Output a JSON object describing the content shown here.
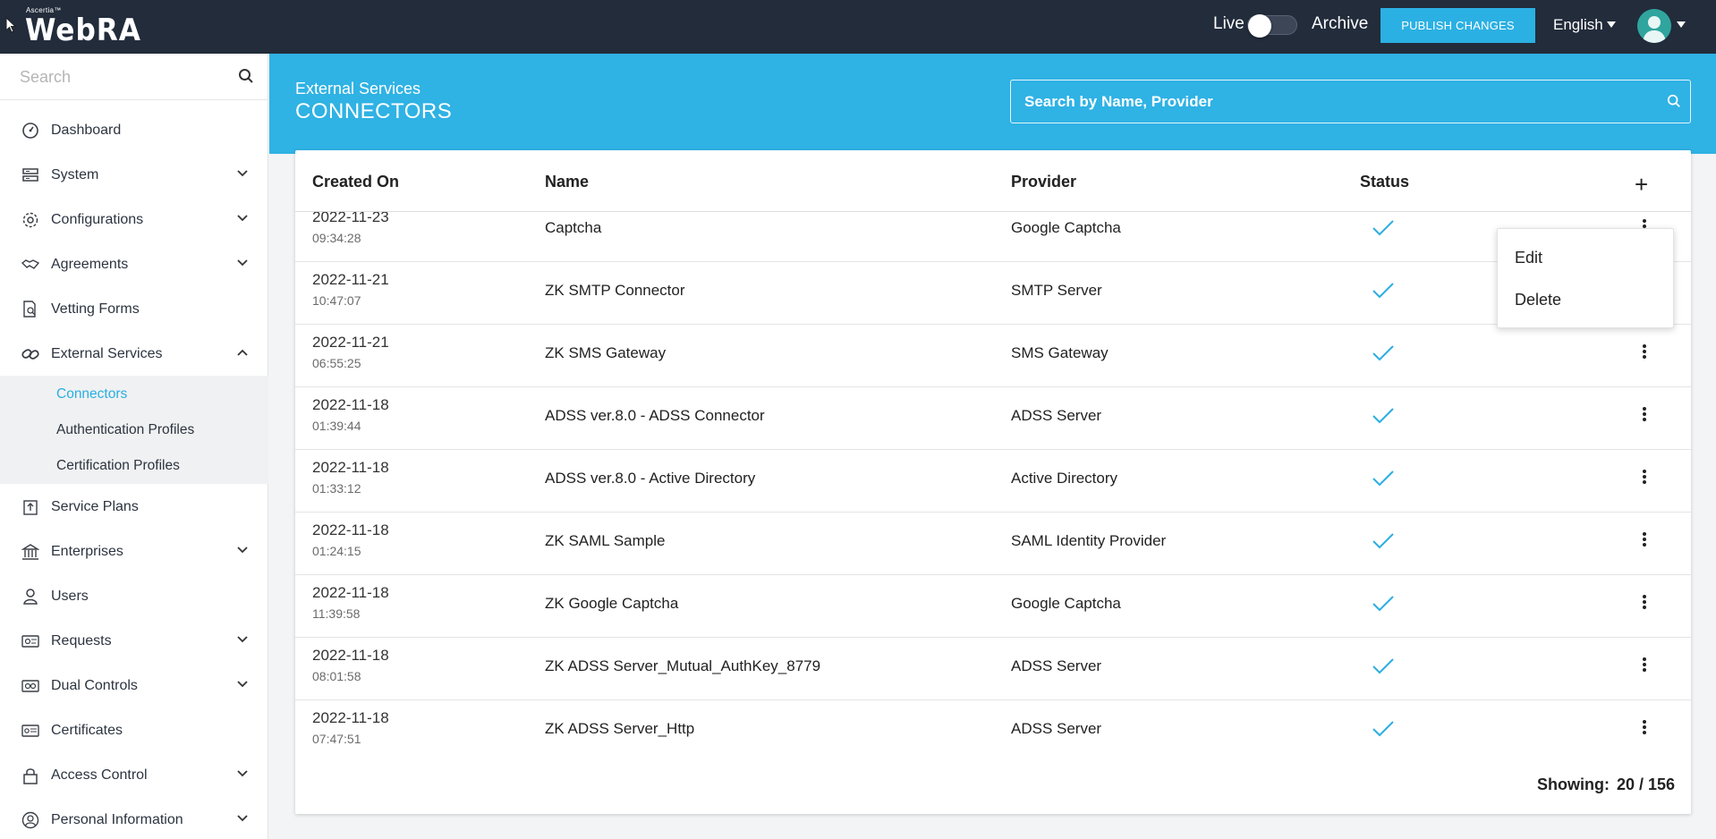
{
  "topbar": {
    "brand_small": "Ascertia™",
    "brand": "WebRA",
    "live_label": "Live",
    "archive_label": "Archive",
    "publish_label": "PUBLISH CHANGES",
    "language": "English"
  },
  "sidebar": {
    "search_placeholder": "Search",
    "items": [
      {
        "label": "Dashboard"
      },
      {
        "label": "System"
      },
      {
        "label": "Configurations"
      },
      {
        "label": "Agreements"
      },
      {
        "label": "Vetting Forms"
      },
      {
        "label": "External Services"
      },
      {
        "label": "Service Plans"
      },
      {
        "label": "Enterprises"
      },
      {
        "label": "Users"
      },
      {
        "label": "Requests"
      },
      {
        "label": "Dual Controls"
      },
      {
        "label": "Certificates"
      },
      {
        "label": "Access Control"
      },
      {
        "label": "Personal Information"
      }
    ],
    "subitems": [
      {
        "label": "Connectors"
      },
      {
        "label": "Authentication Profiles"
      },
      {
        "label": "Certification Profiles"
      }
    ]
  },
  "header": {
    "section": "External Services",
    "title": "CONNECTORS",
    "search_placeholder": "Search by Name, Provider"
  },
  "table": {
    "columns": [
      "Created On",
      "Name",
      "Provider",
      "Status"
    ],
    "rows": [
      {
        "date": "2022-11-23",
        "time": "09:34:28",
        "name": "Captcha",
        "provider": "Google Captcha"
      },
      {
        "date": "2022-11-21",
        "time": "10:47:07",
        "name": "ZK SMTP Connector",
        "provider": "SMTP Server"
      },
      {
        "date": "2022-11-21",
        "time": "06:55:25",
        "name": "ZK SMS Gateway",
        "provider": "SMS Gateway"
      },
      {
        "date": "2022-11-18",
        "time": "01:39:44",
        "name": "ADSS ver.8.0 - ADSS Connector",
        "provider": "ADSS Server"
      },
      {
        "date": "2022-11-18",
        "time": "01:33:12",
        "name": "ADSS ver.8.0 - Active Directory",
        "provider": "Active Directory"
      },
      {
        "date": "2022-11-18",
        "time": "01:24:15",
        "name": "ZK SAML Sample",
        "provider": "SAML Identity Provider"
      },
      {
        "date": "2022-11-18",
        "time": "11:39:58",
        "name": "ZK Google Captcha",
        "provider": "Google Captcha"
      },
      {
        "date": "2022-11-18",
        "time": "08:01:58",
        "name": "ZK ADSS Server_Mutual_AuthKey_8779",
        "provider": "ADSS Server"
      },
      {
        "date": "2022-11-18",
        "time": "07:47:51",
        "name": "ZK ADSS Server_Http",
        "provider": "ADSS Server"
      }
    ],
    "showing_label": "Showing:",
    "showing_value": "20 / 156"
  },
  "context_menu": {
    "edit": "Edit",
    "delete": "Delete"
  },
  "colors": {
    "topbar": "#222c3b",
    "accent": "#2fb2e4",
    "check": "#2aaee2"
  }
}
